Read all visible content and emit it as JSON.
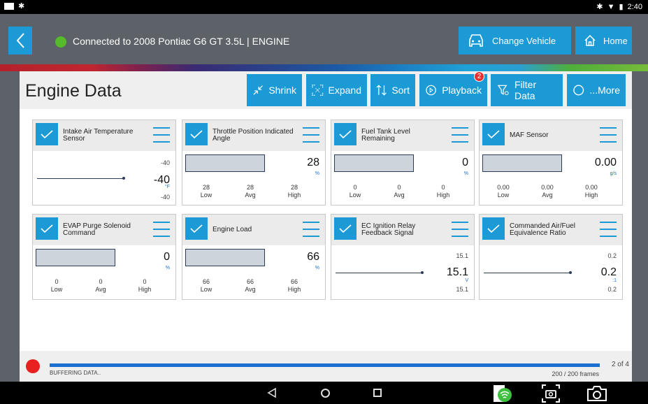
{
  "status_bar": {
    "time": "2:40"
  },
  "header": {
    "connection_text": "Connected to 2008 Pontiac G6 GT 3.5L | ENGINE",
    "change_vehicle_label": "Change Vehicle",
    "home_label": "Home"
  },
  "toolbar": {
    "page_title": "Engine Data",
    "shrink_label": "Shrink",
    "expand_label": "Expand",
    "sort_label": "Sort",
    "playback_label": "Playback",
    "playback_badge": "2",
    "filter_label": "Filter Data",
    "more_label": "...More"
  },
  "cards": [
    {
      "title": "Intake Air Temperature Sensor",
      "type": "line",
      "top": "-40",
      "value": "-40",
      "unit": "°F",
      "bottom": "-40"
    },
    {
      "title": "Throttle Position Indicated Angle",
      "type": "bar",
      "value": "28",
      "unit": "%",
      "low": "28",
      "avg": "28",
      "high": "28"
    },
    {
      "title": "Fuel Tank Level Remaining",
      "type": "bar",
      "value": "0",
      "unit": "%",
      "low": "0",
      "avg": "0",
      "high": "0"
    },
    {
      "title": "MAF Sensor",
      "type": "bar",
      "value": "0.00",
      "unit": "g/s",
      "low": "0.00",
      "avg": "0.00",
      "high": "0.00"
    },
    {
      "title": "EVAP Purge Solenoid Command",
      "type": "bar",
      "value": "0",
      "unit": "%",
      "low": "0",
      "avg": "0",
      "high": "0"
    },
    {
      "title": "Engine Load",
      "type": "bar",
      "value": "66",
      "unit": "%",
      "low": "66",
      "avg": "66",
      "high": "66"
    },
    {
      "title": "EC Ignition Relay Feedback Signal",
      "type": "line",
      "top": "15.1",
      "value": "15.1",
      "unit": "V",
      "bottom": "15.1"
    },
    {
      "title": "Commanded Air/Fuel Equivalence Ratio",
      "type": "line",
      "top": "0.2",
      "value": "0.2",
      "unit": ":1",
      "bottom": "0.2"
    }
  ],
  "stat_labels": {
    "low": "Low",
    "avg": "Avg",
    "high": "High"
  },
  "footer": {
    "buffer_text": "BUFFERING DATA..",
    "frames_text": "200 / 200  frames",
    "page_count": "2 of 4",
    "progress": 1.0
  },
  "colors": {
    "accent": "#1b9ad6",
    "connected": "#55bb2a",
    "record": "#e82020",
    "header": "#5c6268"
  }
}
